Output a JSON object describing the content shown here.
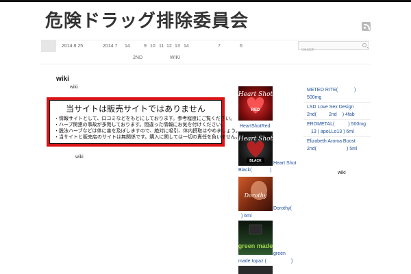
{
  "site": {
    "title": "危険ドラッグ排除委員会"
  },
  "nav": {
    "row1": [
      "2014 8 25",
      "2014 7",
      "14",
      "9",
      "10",
      "11",
      "12",
      "13",
      "14",
      "7",
      "6"
    ],
    "row2": [
      "2ND",
      "WIKI"
    ]
  },
  "search": {
    "placeholder": "Search"
  },
  "post": {
    "title": "wiki",
    "subtitle": "wiki",
    "footer": "wiki",
    "notice": {
      "headline": "当サイトは販売サイトではありません",
      "lines": [
        "・情報サイトとして、口コミなどをもとにしております。参考程度にご覧ください。",
        "・ハーブ関連の事故が多発しております。間違った情報にお気を付けください。",
        "・脱法ハーブなどは体に害を及ぼしますので、絶対に吸引、体内摂取はやめましょう。",
        "・当サイトと販売店のサイトは無関係です。購入に関しては一切の責任を負いません。"
      ]
    }
  },
  "thumbs": [
    {
      "image_text": "Heart Shot",
      "image_sub": "RED",
      "caption": "HeartShotRed",
      "color": "#b01818"
    },
    {
      "image_text": "Heart Shot",
      "image_sub": "BLACK",
      "caption_a": "Heart Shot",
      "caption_b": "Black(",
      "caption_c": ")",
      "color": "#1a1a1a"
    },
    {
      "image_text": "Dorothy",
      "caption_a": "Dorothy(",
      "caption_b": ") 6ml",
      "color": "#8a3a1a"
    },
    {
      "image_text": "green made",
      "caption_a": "green",
      "caption_b": "made topaz (",
      "caption_c": ")",
      "color": "#1c2d1c"
    }
  ],
  "sidebar": {
    "links": [
      {
        "l1": "METEO RITE(",
        "l1b": ")",
        "l2": "500mg"
      },
      {
        "l1": "LSD Love Sex Design",
        "l2": "2nd(",
        "l2b": "2nd",
        "l2c": ") 4fab"
      },
      {
        "l1": "EROMETAL(",
        "l1b": ") 500mg",
        "l2": "13 ( apoLLo13 ) 6ml"
      },
      {
        "l1": "Elizabeth Aroma Boost",
        "l2": "2nd(",
        "l2b": ") 5ml"
      }
    ],
    "wiki": "wiki"
  }
}
